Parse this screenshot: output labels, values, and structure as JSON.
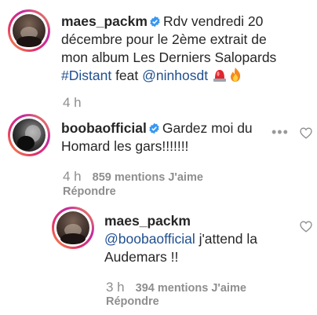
{
  "comments": [
    {
      "username": "maes_packm",
      "verified": true,
      "text_parts": [
        "Rdv vendredi 20 décembre pour le 2ème extrait de mon album Les Derniers Salopards ",
        "#Distant",
        " feat ",
        "@ninhosdt",
        " "
      ],
      "emojis": [
        "siren-emoji",
        "fire-emoji"
      ],
      "time": "4 h"
    },
    {
      "username": "boobaofficial",
      "verified": true,
      "text": "Gardez moi du Homard les gars!!!!!!!",
      "time": "4 h",
      "likes": "859 mentions J'aime",
      "reply_label": "Répondre",
      "more_icon": "ellipsis-icon",
      "like_icon": "heart-outline-icon"
    },
    {
      "username": "maes_packm",
      "verified": false,
      "text_parts": [
        "@boobaofficial",
        " j'attend la Audemars !!"
      ],
      "time": "3 h",
      "likes": "394 mentions J'aime",
      "reply_label": "Répondre",
      "like_icon": "heart-outline-icon"
    }
  ],
  "colors": {
    "link": "#1f4f8f",
    "verified": "#3897f0",
    "muted": "#8e8e8e"
  }
}
